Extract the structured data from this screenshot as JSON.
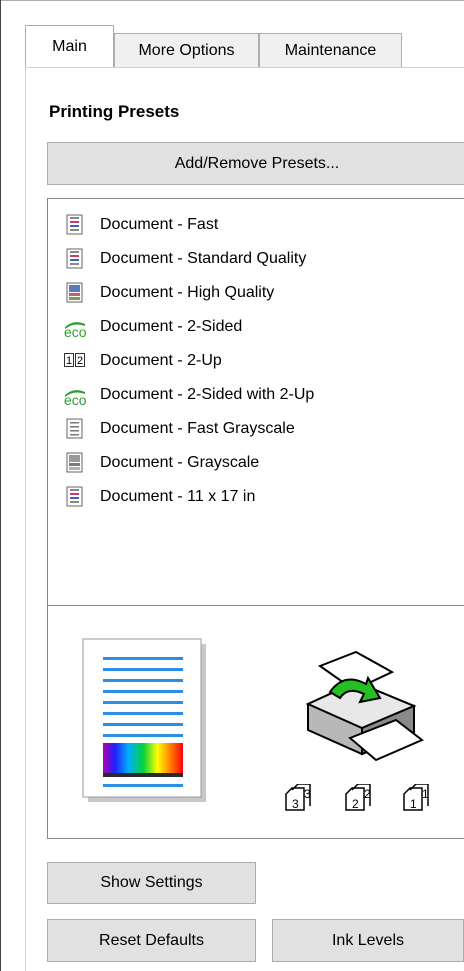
{
  "tabs": [
    {
      "label": "Main",
      "active": true
    },
    {
      "label": "More Options",
      "active": false
    },
    {
      "label": "Maintenance",
      "active": false
    }
  ],
  "presets_section": {
    "title": "Printing Presets",
    "add_remove_label": "Add/Remove Presets...",
    "items": [
      {
        "label": "Document - Fast",
        "icon": "document-icon"
      },
      {
        "label": "Document - Standard Quality",
        "icon": "document-icon"
      },
      {
        "label": "Document - High Quality",
        "icon": "document-photo-icon"
      },
      {
        "label": "Document - 2-Sided",
        "icon": "eco-icon"
      },
      {
        "label": "Document - 2-Up",
        "icon": "two-up-icon"
      },
      {
        "label": "Document - 2-Sided with 2-Up",
        "icon": "eco-icon"
      },
      {
        "label": "Document - Fast Grayscale",
        "icon": "document-gray-icon"
      },
      {
        "label": "Document - Grayscale",
        "icon": "document-gray-icon"
      },
      {
        "label": "Document - 11 x 17 in",
        "icon": "document-icon"
      }
    ]
  },
  "preview": {
    "collate_numbers": [
      "3",
      "2",
      "1"
    ],
    "eco_text": "eco",
    "two_up_digits": [
      "1",
      "2"
    ]
  },
  "buttons": {
    "show_settings": "Show Settings",
    "reset_defaults": "Reset Defaults",
    "ink_levels": "Ink Levels"
  },
  "colors": {
    "eco_green": "#2e9e2e",
    "arrow_green": "#22c022",
    "page_lines_blue": "#2b8fe8",
    "button_face": "#e1e1e1",
    "border": "#adadad"
  }
}
